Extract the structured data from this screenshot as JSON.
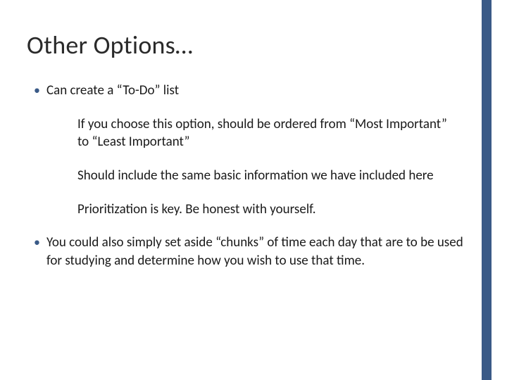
{
  "title": "Other Options…",
  "bullets": {
    "b1": "Can create a “To-Do” list",
    "s1": "If you choose this option, should be ordered from “Most Important” to “Least Important”",
    "s2": "Should include the same basic information we have included here",
    "s3": "Prioritization is key. Be honest with yourself.",
    "b2": "You could also simply set aside “chunks” of time each day that are to be used for studying and determine how you wish to use that time."
  }
}
